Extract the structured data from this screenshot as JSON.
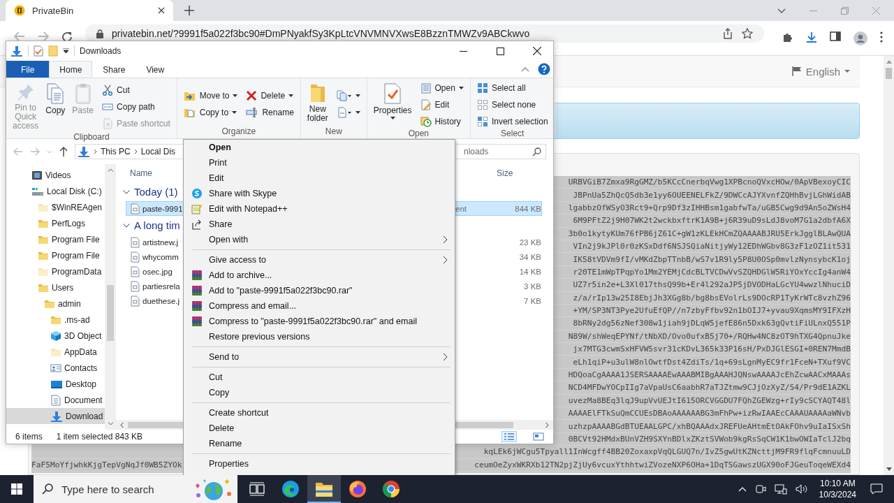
{
  "browser": {
    "tab": {
      "title": "PrivateBin"
    },
    "url": "privatebin.net/?9991f5a022f3bc90#DmPNyakfSy3KpLtcVNVMNVXwsE8BzznTMWZv9ABCkwvo",
    "language": "English",
    "paste_lines": [
      "URBVGiB7Zmxa9RgGMZ/b5KCcCnerbqVwg1XPBcnoQVxcHOw/0ApVBexoyCIC",
      "JBPnUa5ZhQcQ5db3e1yy6OUEENELFkZ/9DWCcAJYXvnfZQHhBvjLGhWidAB",
      "lgabbzOfWSyO3Rct9+Qrp9Df3zIHHBsm1gabfwTa/uGB5Cwg9d9An5oZWsH4",
      "6M9PFtZ2j9H07WK2t2wckbxftrK1A9B+j6R39uD9sLdJ8voM7G1a2dbfA6X",
      "3b0o1kytyKUm76fPB6jZ61C+gW1zKLEkHCmZQAAAABJRU5ErkJgglBLAwQUA",
      "VIn2j9kJPl0r0zKSxDdf6NSJSQiaNitjyWy12EDhWGbv8G3zF1zOZ1it531",
      "IK58tVDVm9fI/vMKdZbpTTnbB/wS7v1R9ly5P8U0OSp0mvlzNynsybcK1oj",
      "r20TE1mWpTPqpYo1Mm2YEMjCdcBLTVCDwVvSZQHDGlW5RiYOxYccIg4anW4",
      "UZ7r5in2e+L3Xl017thsQ99b+Er4l292aJP5jDVODHaLGcYU4wwzlNhuciD",
      "z/a/rIp13w25I8EbjJh3XGg8b/bg8bsEVolrLs9DOcRP1TyKrWTc8vzhZ96",
      "+YM/SP3NT3Pye2UfuEfQP//n7zbyFfbv92n1bOIJ7+yvau9XqmsMY9IFXzH",
      "8bRNy2dg56zNef308w1jiah9jDLqW5jefE86n5Dxk63gQvtiFiULnxQ551P",
      "N89W/shWeqEPYNf/tNbXD/Ovo0ufxB5j70+/RQHw4NC8zOT9hTXG4QpnuJke",
      "jx7MTG3cwmSxHFVW5svr31cKDvL365k33P16sH/PxDJGlESGI+0REN7MmdB",
      "eLh1qiP+u3ulW8nlOwtfDst4ZdiTs/1q+69sLgnMyEC9fr1FceN+TXuf9VC",
      "HDQoaCgAAAA1JSERSAAAAEwAAABMIBgAAAHJQNswAAAAJcEhZcwAACxMAAAs",
      "NCD4MFDwYOCpIIg7aVpaUsC6aabhR7aTJZtmw9CJjOzXyZ/S4/Pr9dE1AZKL",
      "uvezMa8BEq3lqJ9upVvUEJtI615ORCVGGDU7FQhZGEWzg+rIy9cSCYAQT48l",
      "AAAAElFTkSuQmCCUEsDBAoAAAAAABG3mFhPw+izRwIAAEcCAAAUAAAAaWNvb",
      "uzhzpAAAABGdBTUEAALGPC/xhBQAAAdxJREFUeAHtmEtOAkFOhv9uIaISxSh",
      "0BCVt92HMdxBUnVZH9SXYnBDlxZKztSVWob9kgRsSqCW1K1bwOWIaTclJ2bq"
    ],
    "paste_tail": [
      {
        "right": "kqLEk6jWCgu5Tpyall1InWcgff4BB20ZoxaxpVqQLGUQ7n/IvZ5gwUtKZNcttjM9FR9flqFcmnuuLD"
      },
      {
        "left": "FaF5MoYfjwhkKjgTepVgNqJf0WB5ZYOk",
        "right": "ceumOeZyxWKRXb12TN2pjZjUy6vcuxYthhtwiZVozeNXP6OHa+1DqTSGawszUGX90oFJGeuToqeWEXd4"
      }
    ]
  },
  "explorer": {
    "title": "Downloads",
    "ribbon_tabs": [
      {
        "label": "File",
        "kind": "file",
        "selected": false
      },
      {
        "label": "Home",
        "kind": "tab",
        "selected": true
      },
      {
        "label": "Share",
        "kind": "tab",
        "selected": false
      },
      {
        "label": "View",
        "kind": "tab",
        "selected": false
      }
    ],
    "ribbon_groups": [
      {
        "label": "Clipboard",
        "columns": [
          [
            {
              "label": "Pin to Quick access",
              "kind": "large",
              "dropdown": false,
              "disabled": true
            },
            {
              "label": "Copy",
              "kind": "large",
              "dropdown": false,
              "disabled": false
            },
            {
              "label": "Paste",
              "kind": "large",
              "dropdown": false,
              "disabled": true
            }
          ],
          [
            {
              "label": "Cut",
              "kind": "small",
              "dropdown": false,
              "disabled": false
            },
            {
              "label": "Copy path",
              "kind": "small",
              "dropdown": false,
              "disabled": false
            },
            {
              "label": "Paste shortcut",
              "kind": "small",
              "dropdown": false,
              "disabled": true
            }
          ]
        ]
      },
      {
        "label": "Organize",
        "columns": [
          [
            {
              "label": "Move to",
              "kind": "small",
              "dropdown": true,
              "disabled": false
            },
            {
              "label": "Copy to",
              "kind": "small",
              "dropdown": true,
              "disabled": false
            }
          ],
          [
            {
              "label": "Delete",
              "kind": "small",
              "dropdown": true,
              "disabled": false
            },
            {
              "label": "Rename",
              "kind": "small",
              "dropdown": false,
              "disabled": false
            }
          ]
        ]
      },
      {
        "label": "New",
        "columns": [
          [
            {
              "label": "New folder",
              "kind": "large",
              "dropdown": false,
              "disabled": false
            }
          ],
          [
            {
              "kind": "small",
              "dropdown": true,
              "disabled": false
            },
            {
              "kind": "small",
              "dropdown": true,
              "disabled": false
            }
          ]
        ]
      },
      {
        "label": "Open",
        "columns": [
          [
            {
              "label": "Properties",
              "kind": "large",
              "dropdown": true,
              "disabled": false
            }
          ],
          [
            {
              "label": "Open",
              "kind": "small",
              "dropdown": true,
              "disabled": false
            },
            {
              "label": "Edit",
              "kind": "small",
              "dropdown": false,
              "disabled": false
            },
            {
              "label": "History",
              "kind": "small",
              "dropdown": false,
              "disabled": false
            }
          ]
        ]
      },
      {
        "label": "Select",
        "columns": [
          [
            {
              "label": "Select all",
              "kind": "small",
              "dropdown": false,
              "disabled": false
            },
            {
              "label": "Select none",
              "kind": "small",
              "dropdown": false,
              "disabled": false
            },
            {
              "label": "Invert selection",
              "kind": "small",
              "dropdown": false,
              "disabled": false
            }
          ]
        ]
      }
    ],
    "path": [
      "This PC",
      "Local Dis"
    ],
    "search": {
      "placeholder": "nloads"
    },
    "nav_tree": [
      {
        "label": "Videos",
        "kind": "videos",
        "hidden": false,
        "selected": false
      },
      {
        "label": "Local Disk (C:)",
        "kind": "drive",
        "hidden": false,
        "selected": false,
        "children": [
          {
            "label": "$WinREAgen",
            "kind": "folder",
            "hidden": true,
            "selected": false
          },
          {
            "label": "PerfLogs",
            "kind": "folder",
            "hidden": false,
            "selected": false
          },
          {
            "label": "Program File",
            "kind": "folder",
            "hidden": false,
            "selected": false
          },
          {
            "label": "Program File",
            "kind": "folder",
            "hidden": false,
            "selected": false
          },
          {
            "label": "ProgramData",
            "kind": "folder",
            "hidden": true,
            "selected": false
          },
          {
            "label": "Users",
            "kind": "folder",
            "hidden": false,
            "selected": false,
            "children": [
              {
                "label": "admin",
                "kind": "folder",
                "hidden": false,
                "selected": false,
                "children": [
                  {
                    "label": ".ms-ad",
                    "kind": "folder",
                    "hidden": false,
                    "selected": false
                  },
                  {
                    "label": "3D Object",
                    "kind": "objects3d",
                    "hidden": false,
                    "selected": false
                  },
                  {
                    "label": "AppData",
                    "kind": "folder",
                    "hidden": true,
                    "selected": false
                  },
                  {
                    "label": "Contacts",
                    "kind": "contacts",
                    "hidden": false,
                    "selected": false
                  },
                  {
                    "label": "Desktop",
                    "kind": "desktop",
                    "hidden": false,
                    "selected": false
                  },
                  {
                    "label": "Document",
                    "kind": "documents",
                    "hidden": false,
                    "selected": false
                  },
                  {
                    "label": "Download",
                    "kind": "downloads",
                    "hidden": false,
                    "selected": true
                  }
                ]
              }
            ]
          }
        ]
      }
    ],
    "columns": [
      {
        "label": "Name"
      },
      {
        "label": "Size"
      }
    ],
    "groups": [
      {
        "label": "Today (1)",
        "expanded": true,
        "files": [
          {
            "name": "paste-9991",
            "type": "ent",
            "size": "844 KB",
            "selected": true
          }
        ]
      },
      {
        "label": "A long tim",
        "expanded": true,
        "files": [
          {
            "name": "artistnew.j",
            "size": "23 KB",
            "selected": false
          },
          {
            "name": "whycomm",
            "size": "34 KB",
            "selected": false
          },
          {
            "name": "osec.jpg",
            "size": "14 KB",
            "selected": false
          },
          {
            "name": "partiesrela",
            "size": "3 KB",
            "selected": false
          },
          {
            "name": "duethese.j",
            "size": "7 KB",
            "selected": false
          }
        ]
      }
    ],
    "status": {
      "items": "6 items",
      "selection": "1 item selected  843 KB"
    },
    "view_modes": [
      {
        "kind": "details",
        "selected": true
      },
      {
        "kind": "tiles",
        "selected": false
      }
    ]
  },
  "context_menu": {
    "items": [
      {
        "kind": "item",
        "label": "Open",
        "default": true,
        "submenu": false
      },
      {
        "kind": "item",
        "label": "Print",
        "default": false,
        "submenu": false
      },
      {
        "kind": "item",
        "label": "Edit",
        "default": false,
        "submenu": false
      },
      {
        "kind": "item",
        "label": "Share with Skype",
        "default": false,
        "submenu": false
      },
      {
        "kind": "item",
        "label": "Edit with Notepad++",
        "default": false,
        "submenu": false
      },
      {
        "kind": "item",
        "label": "Share",
        "default": false,
        "submenu": false
      },
      {
        "kind": "item",
        "label": "Open with",
        "default": false,
        "submenu": true
      },
      {
        "kind": "separator"
      },
      {
        "kind": "item",
        "label": "Give access to",
        "default": false,
        "submenu": true
      },
      {
        "kind": "item",
        "label": "Add to archive...",
        "default": false,
        "submenu": false
      },
      {
        "kind": "item",
        "label": "Add to \"paste-9991f5a022f3bc90.rar\"",
        "default": false,
        "submenu": false
      },
      {
        "kind": "item",
        "label": "Compress and email...",
        "default": false,
        "submenu": false
      },
      {
        "kind": "item",
        "label": "Compress to \"paste-9991f5a022f3bc90.rar\" and email",
        "default": false,
        "submenu": false
      },
      {
        "kind": "item",
        "label": "Restore previous versions",
        "default": false,
        "submenu": false
      },
      {
        "kind": "separator"
      },
      {
        "kind": "item",
        "label": "Send to",
        "default": false,
        "submenu": true
      },
      {
        "kind": "separator"
      },
      {
        "kind": "item",
        "label": "Cut",
        "default": false,
        "submenu": false
      },
      {
        "kind": "item",
        "label": "Copy",
        "default": false,
        "submenu": false
      },
      {
        "kind": "separator"
      },
      {
        "kind": "item",
        "label": "Create shortcut",
        "default": false,
        "submenu": false
      },
      {
        "kind": "item",
        "label": "Delete",
        "default": false,
        "submenu": false
      },
      {
        "kind": "item",
        "label": "Rename",
        "default": false,
        "submenu": false
      },
      {
        "kind": "separator"
      },
      {
        "kind": "item",
        "label": "Properties",
        "default": false,
        "submenu": false
      }
    ]
  },
  "taskbar": {
    "search": {
      "placeholder": "Type here to search"
    },
    "apps": [
      {
        "kind": "taskview",
        "active": false
      },
      {
        "kind": "edge",
        "active": false
      },
      {
        "kind": "explorer",
        "active": true
      },
      {
        "kind": "firefox",
        "active": false
      },
      {
        "kind": "chrome",
        "active": false
      }
    ],
    "time": "10:10 AM",
    "date": "10/3/2024"
  }
}
